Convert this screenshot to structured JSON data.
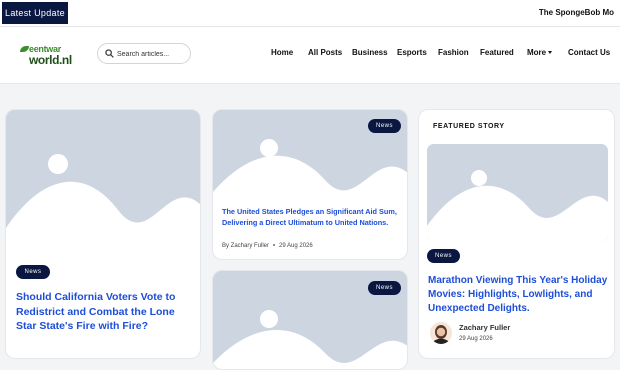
{
  "ticker": {
    "badge": "Latest Update",
    "headline": "The SpongeBob Mo"
  },
  "logo": {
    "line1": "eentwar",
    "line2": "world.nl"
  },
  "search": {
    "placeholder": "Search articles..."
  },
  "nav": [
    {
      "label": "Home"
    },
    {
      "label": "All Posts"
    },
    {
      "label": "Business"
    },
    {
      "label": "Esports"
    },
    {
      "label": "Fashion"
    },
    {
      "label": "Featured"
    },
    {
      "label": "More"
    },
    {
      "label": "Contact Us"
    }
  ],
  "cards": {
    "left": {
      "badge": "News",
      "title": "Should California Voters Vote to Redistrict and Combat the Lone Star State's Fire with Fire?"
    },
    "middle_top": {
      "badge": "News",
      "title": "The United States Pledges an Significant Aid Sum, Delivering a Direct Ultimatum to United Nations.",
      "author": "By Zachary Fuller",
      "date": "29 Aug 2026"
    },
    "middle_bottom": {
      "badge": "News"
    }
  },
  "featured": {
    "heading": "FEATURED STORY",
    "badge": "News",
    "title": "Marathon Viewing This Year's Holiday Movies: Highlights, Lowlights, and Unexpected Delights.",
    "author": "Zachary Fuller",
    "date": "29 Aug 2026"
  },
  "colors": {
    "navy": "#0a1740",
    "title_blue": "#1d4ed8",
    "placeholder_bg": "#cdd6e0"
  }
}
